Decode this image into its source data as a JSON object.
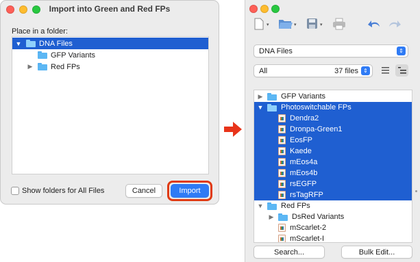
{
  "dialog": {
    "title": "Import into Green and Red FPs",
    "folder_label": "Place in a folder:",
    "tree": [
      {
        "label": "DNA Files",
        "indent": 0,
        "disclosure": "down",
        "selected": true
      },
      {
        "label": "GFP Variants",
        "indent": 1,
        "disclosure": "none",
        "selected": false
      },
      {
        "label": "Red FPs",
        "indent": 1,
        "disclosure": "right",
        "selected": false
      }
    ],
    "checkbox_label": "Show folders for All Files",
    "cancel_label": "Cancel",
    "import_label": "Import"
  },
  "colors": {
    "selection": "#1f5fd1",
    "primary_button": "#2f7bf5",
    "highlight": "#e03a12",
    "arrow": "#e8341a",
    "folder": "#5cb7f4"
  },
  "toolbar": {
    "icons": [
      "new-document-icon",
      "open-folder-icon",
      "save-icon",
      "print-icon",
      "undo-icon",
      "redo-icon"
    ]
  },
  "collection_select": {
    "value": "DNA Files"
  },
  "filter": {
    "value": "All",
    "count": "37 files"
  },
  "file_list": [
    {
      "label": "GFP Variants",
      "kind": "folder",
      "indent": 0,
      "disclosure": "right",
      "selected": false
    },
    {
      "label": "Photoswitchable FPs",
      "kind": "folder",
      "indent": 0,
      "disclosure": "down",
      "selected": true
    },
    {
      "label": "Dendra2",
      "kind": "file",
      "indent": 1,
      "disclosure": "none",
      "selected": true
    },
    {
      "label": "Dronpa-Green1",
      "kind": "file",
      "indent": 1,
      "disclosure": "none",
      "selected": true
    },
    {
      "label": "EosFP",
      "kind": "file",
      "indent": 1,
      "disclosure": "none",
      "selected": true
    },
    {
      "label": "Kaede",
      "kind": "file",
      "indent": 1,
      "disclosure": "none",
      "selected": true
    },
    {
      "label": "mEos4a",
      "kind": "file",
      "indent": 1,
      "disclosure": "none",
      "selected": true
    },
    {
      "label": "mEos4b",
      "kind": "file",
      "indent": 1,
      "disclosure": "none",
      "selected": true
    },
    {
      "label": "rsEGFP",
      "kind": "file",
      "indent": 1,
      "disclosure": "none",
      "selected": true
    },
    {
      "label": "rsTagRFP",
      "kind": "file",
      "indent": 1,
      "disclosure": "none",
      "selected": true
    },
    {
      "label": "Red FPs",
      "kind": "folder",
      "indent": 0,
      "disclosure": "down",
      "selected": false
    },
    {
      "label": "DsRed Variants",
      "kind": "folder",
      "indent": 1,
      "disclosure": "right",
      "selected": false
    },
    {
      "label": "mScarlet-2",
      "kind": "file",
      "indent": 1,
      "disclosure": "none",
      "selected": false
    },
    {
      "label": "mScarlet-I",
      "kind": "file",
      "indent": 1,
      "disclosure": "none",
      "selected": false
    }
  ],
  "bottom": {
    "search_label": "Search...",
    "bulk_label": "Bulk Edit..."
  }
}
